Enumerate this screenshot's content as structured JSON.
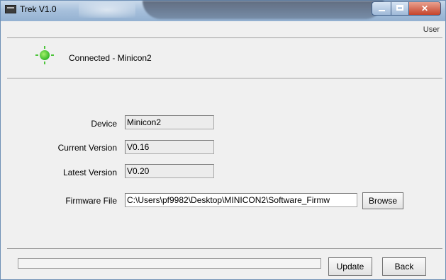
{
  "window": {
    "title": "Trek V1.0"
  },
  "header": {
    "user_label": "User"
  },
  "status": {
    "text": "Connected - Minicon2",
    "led_color": "#35b828"
  },
  "form": {
    "device_label": "Device",
    "device_value": "Minicon2",
    "current_version_label": "Current Version",
    "current_version_value": "V0.16",
    "latest_version_label": "Latest Version",
    "latest_version_value": "V0.20",
    "firmware_file_label": "Firmware File",
    "firmware_file_value": "C:\\Users\\pf9982\\Desktop\\MINICON2\\Software_Firmw",
    "browse_label": "Browse"
  },
  "footer": {
    "progress": 0,
    "update_label": "Update",
    "back_label": "Back"
  }
}
